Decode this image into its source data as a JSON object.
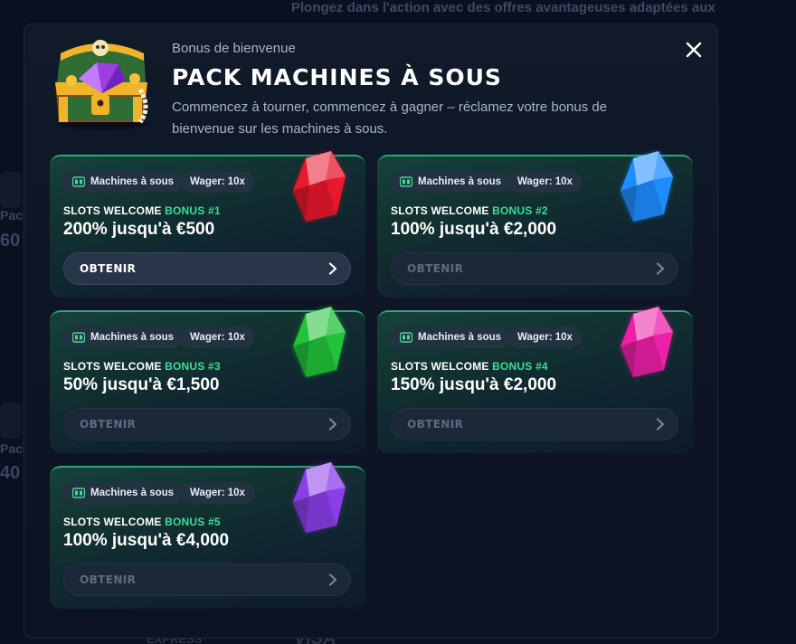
{
  "background": {
    "top_text": "Plongez dans l'action avec des offres avantageuses adaptées aux",
    "left_labels": [
      "Pack",
      "60",
      "Pack",
      "40"
    ],
    "footer_texts": [
      "EXPRESS",
      "VISA"
    ]
  },
  "modal": {
    "subtitle": "Bonus de bienvenue",
    "title": "PACK MACHINES À SOUS",
    "description": "Commencez à tourner, commencez à gagner – réclamez votre bonus de bienvenue sur les machines à sous.",
    "close_icon": "close-icon",
    "chest_icon": "treasure-chest-icon"
  },
  "cards": [
    {
      "chip_type": "Machines à sous",
      "chip_wager": "Wager: 10x",
      "label_main": "SLOTS WELCOME ",
      "label_hl": "BONUS #1",
      "value": "200% jusqu'à €500",
      "cta": "OBTENIR",
      "cta_state": "active",
      "gem_color": "#e8192c",
      "gem_icon": "red-gem-icon"
    },
    {
      "chip_type": "Machines à sous",
      "chip_wager": "Wager: 10x",
      "label_main": "SLOTS WELCOME ",
      "label_hl": "BONUS #2",
      "value": "100% jusqu'à €2,000",
      "cta": "OBTENIR",
      "cta_state": "disabled",
      "gem_color": "#1e8cff",
      "gem_icon": "blue-gem-icon"
    },
    {
      "chip_type": "Machines à sous",
      "chip_wager": "Wager: 10x",
      "label_main": "SLOTS WELCOME ",
      "label_hl": "BONUS #3",
      "value": "50% jusqu'à €1,500",
      "cta": "OBTENIR",
      "cta_state": "disabled",
      "gem_color": "#22c23a",
      "gem_icon": "green-gem-icon"
    },
    {
      "chip_type": "Machines à sous",
      "chip_wager": "Wager: 10x",
      "label_main": "SLOTS WELCOME ",
      "label_hl": "BONUS #4",
      "value": "150% jusqu'à €2,000",
      "cta": "OBTENIR",
      "cta_state": "disabled",
      "gem_color": "#ec1fa6",
      "gem_icon": "pink-gem-icon"
    },
    {
      "chip_type": "Machines à sous",
      "chip_wager": "Wager: 10x",
      "label_main": "SLOTS WELCOME ",
      "label_hl": "BONUS #5",
      "value": "100% jusqu'à €4,000",
      "cta": "OBTENIR",
      "cta_state": "disabled",
      "gem_color": "#8a3ee8",
      "gem_icon": "purple-gem-icon"
    }
  ],
  "colors": {
    "accent_green": "#3ddc97",
    "card_border": "#2ea57a",
    "background": "#0b1020"
  }
}
